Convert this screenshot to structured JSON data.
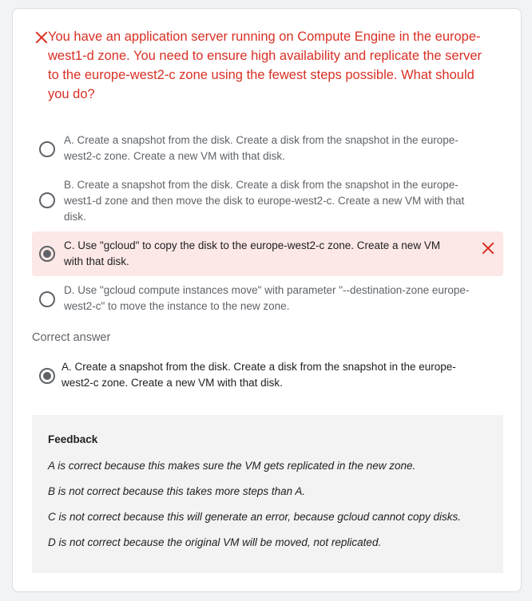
{
  "question": {
    "status_icon": "close-icon",
    "text": "You have an application server running on Compute Engine in the europe-west1-d zone. You need to ensure high availability and replicate the server to the europe-west2-c zone using the fewest steps possible. What should you do?"
  },
  "options": [
    {
      "line1": "A. Create a snapshot from the disk. Create a disk from the snapshot in the europe-",
      "line2": "west2-c zone. Create a new VM with that disk.",
      "line3": ""
    },
    {
      "line1": "B. Create a snapshot from the disk. Create a disk from the snapshot in the europe-",
      "line2": "west1-d zone and then move the disk to europe-west2-c. Create a new VM with that",
      "line3": "disk."
    },
    {
      "line1": "C. Use \"gcloud\" to copy the disk to the europe-west2-c zone. Create a new VM",
      "line2": "with that disk.",
      "line3": "",
      "selected": true,
      "wrong": true
    },
    {
      "line1": "D. Use \"gcloud compute instances move\" with parameter \"--destination-zone europe-",
      "line2": "west2-c\" to move the instance to the new zone.",
      "line3": ""
    }
  ],
  "correct": {
    "label": "Correct answer",
    "line1": "A. Create a snapshot from the disk. Create a disk from the snapshot in the europe-",
    "line2": "west2-c zone. Create a new VM with that disk."
  },
  "feedback": {
    "title": "Feedback",
    "lines": [
      "A is correct because this makes sure the VM gets replicated in the new zone.",
      "B is not correct because this takes more steps than A.",
      "C is not correct because this will generate an error, because gcloud cannot copy disks.",
      "D is not correct because the original VM will be moved, not replicated."
    ]
  },
  "colors": {
    "error": "#d93025",
    "wrong_bg": "#fce8e6",
    "radio": "#5f6368",
    "feedback_bg": "#f3f3f3"
  }
}
